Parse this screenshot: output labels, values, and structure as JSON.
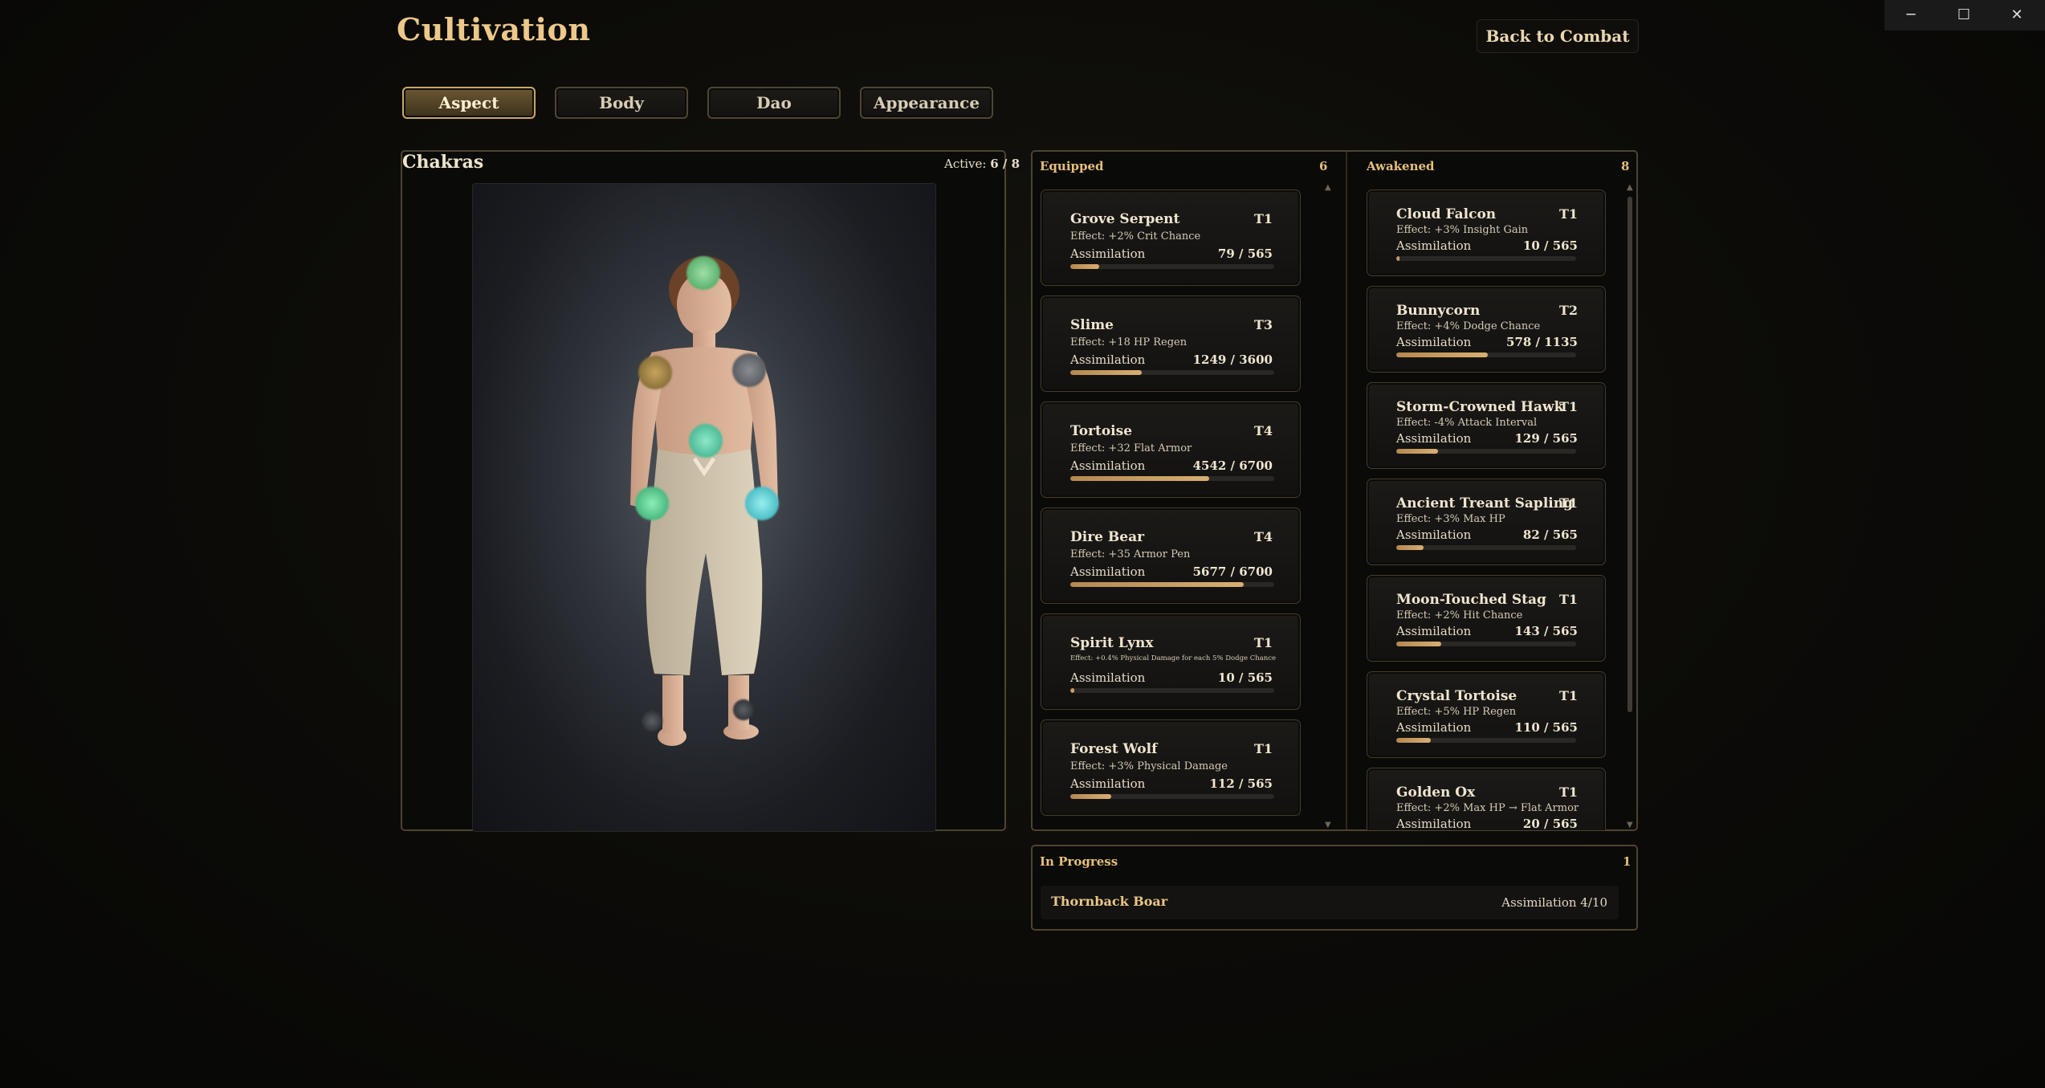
{
  "app_title": "Cultivation",
  "back_button": "Back to Combat",
  "window_controls": {
    "minimize": "─",
    "maximize": "☐",
    "close": "✕"
  },
  "tabs": [
    {
      "label": "Aspect",
      "active": true
    },
    {
      "label": "Body",
      "active": false
    },
    {
      "label": "Dao",
      "active": false
    },
    {
      "label": "Appearance",
      "active": false
    }
  ],
  "chakras": {
    "title": "Chakras",
    "active_label": "Active:",
    "active_value": "6 / 8"
  },
  "equipped": {
    "title": "Equipped",
    "count": "6",
    "items": [
      {
        "name": "Grove Serpent",
        "tier": "T1",
        "effect": "Effect: +2% Crit Chance",
        "assim_label": "Assimilation",
        "value": "79 / 565",
        "progress": 0.14
      },
      {
        "name": "Slime",
        "tier": "T3",
        "effect": "Effect: +18 HP Regen",
        "assim_label": "Assimilation",
        "value": "1249 / 3600",
        "progress": 0.35
      },
      {
        "name": "Tortoise",
        "tier": "T4",
        "effect": "Effect: +32 Flat Armor",
        "assim_label": "Assimilation",
        "value": "4542 / 6700",
        "progress": 0.68
      },
      {
        "name": "Dire Bear",
        "tier": "T4",
        "effect": "Effect: +35 Armor Pen",
        "assim_label": "Assimilation",
        "value": "5677 / 6700",
        "progress": 0.85
      },
      {
        "name": "Spirit Lynx",
        "tier": "T1",
        "effect": "Effect: +0.4% Physical Damage for each 5% Dodge Chance",
        "assim_label": "Assimilation",
        "value": "10 / 565",
        "progress": 0.02
      },
      {
        "name": "Forest Wolf",
        "tier": "T1",
        "effect": "Effect: +3% Physical Damage",
        "assim_label": "Assimilation",
        "value": "112 / 565",
        "progress": 0.2
      }
    ]
  },
  "awakened": {
    "title": "Awakened",
    "count": "8",
    "items": [
      {
        "name": "Cloud Falcon",
        "tier": "T1",
        "effect": "Effect: +3% Insight Gain",
        "assim_label": "Assimilation",
        "value": "10 / 565",
        "progress": 0.02
      },
      {
        "name": "Bunnycorn",
        "tier": "T2",
        "effect": "Effect: +4% Dodge Chance",
        "assim_label": "Assimilation",
        "value": "578 / 1135",
        "progress": 0.51
      },
      {
        "name": "Storm-Crowned Hawk",
        "tier": "T1",
        "effect": "Effect: -4% Attack Interval",
        "assim_label": "Assimilation",
        "value": "129 / 565",
        "progress": 0.23
      },
      {
        "name": "Ancient Treant Sapling",
        "tier": "T1",
        "effect": "Effect: +3% Max HP",
        "assim_label": "Assimilation",
        "value": "82 / 565",
        "progress": 0.15
      },
      {
        "name": "Moon-Touched Stag",
        "tier": "T1",
        "effect": "Effect: +2% Hit Chance",
        "assim_label": "Assimilation",
        "value": "143 / 565",
        "progress": 0.25
      },
      {
        "name": "Crystal Tortoise",
        "tier": "T1",
        "effect": "Effect: +5% HP Regen",
        "assim_label": "Assimilation",
        "value": "110 / 565",
        "progress": 0.19
      },
      {
        "name": "Golden Ox",
        "tier": "T1",
        "effect": "Effect: +2% Max HP → Flat Armor",
        "assim_label": "Assimilation",
        "value": "20 / 565",
        "progress": 0.04
      }
    ]
  },
  "in_progress": {
    "title": "In Progress",
    "count": "1",
    "item_name": "Thornback Boar",
    "item_status": "Assimilation 4/10"
  },
  "colors": {
    "accent_gold": "#e9c785",
    "panel_border": "#4d4330",
    "bar_fill": "#d8ae72"
  }
}
